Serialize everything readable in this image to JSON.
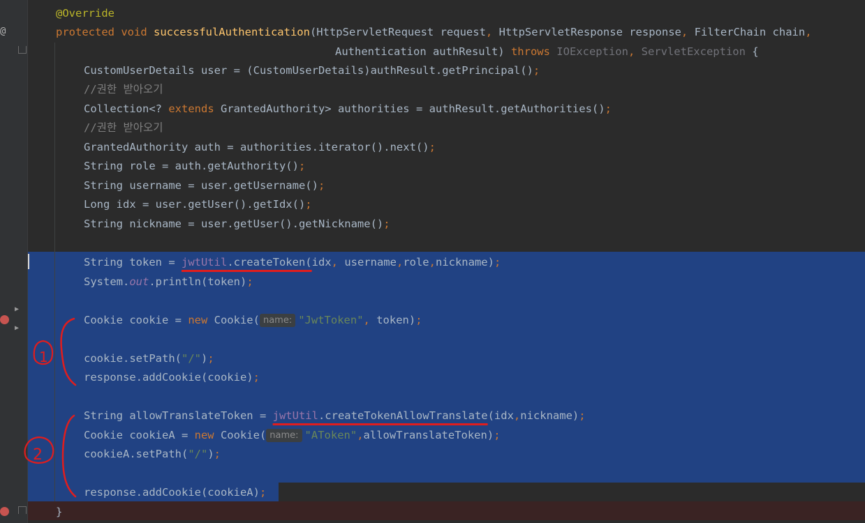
{
  "editor": {
    "lines": [
      {
        "id": "l1",
        "tokens": [
          {
            "t": "@Override",
            "c": "ann"
          }
        ]
      },
      {
        "id": "l2",
        "tokens": [
          {
            "t": "protected void ",
            "c": "kw"
          },
          {
            "t": "successfulAuthentication",
            "c": "fn"
          },
          {
            "t": "(HttpServletRequest request"
          },
          {
            "t": ", ",
            "c": "kw"
          },
          {
            "t": "HttpServletResponse response"
          },
          {
            "t": ", ",
            "c": "kw"
          },
          {
            "t": "FilterChain chain"
          },
          {
            "t": ",",
            "c": "kw"
          }
        ]
      },
      {
        "id": "l3",
        "tokens": [
          {
            "t": "Authentication authResult) "
          },
          {
            "t": "throws ",
            "c": "kw"
          },
          {
            "t": "IOException",
            "c": "dim"
          },
          {
            "t": ", ",
            "c": "kw"
          },
          {
            "t": "ServletException",
            "c": "dim"
          },
          {
            "t": " {"
          }
        ]
      },
      {
        "id": "l4",
        "tokens": [
          {
            "t": "CustomUserDetails user = (CustomUserDetails)authResult.getPrincipal()"
          },
          {
            "t": ";",
            "c": "kw"
          }
        ]
      },
      {
        "id": "l5",
        "tokens": [
          {
            "t": "//권한 받아오기",
            "c": "cm"
          }
        ]
      },
      {
        "id": "l6",
        "tokens": [
          {
            "t": "Collection<? "
          },
          {
            "t": "extends ",
            "c": "kw"
          },
          {
            "t": "GrantedAuthority> authorities = authResult.getAuthorities()"
          },
          {
            "t": ";",
            "c": "kw"
          }
        ]
      },
      {
        "id": "l7",
        "tokens": [
          {
            "t": "//권한 받아오기",
            "c": "cm"
          }
        ]
      },
      {
        "id": "l8",
        "tokens": [
          {
            "t": "GrantedAuthority auth = authorities.iterator().next()"
          },
          {
            "t": ";",
            "c": "kw"
          }
        ]
      },
      {
        "id": "l9",
        "tokens": [
          {
            "t": "String role = auth.getAuthority()"
          },
          {
            "t": ";",
            "c": "kw"
          }
        ]
      },
      {
        "id": "l10",
        "tokens": [
          {
            "t": "String username = user.getUsername()"
          },
          {
            "t": ";",
            "c": "kw"
          }
        ]
      },
      {
        "id": "l11",
        "tokens": [
          {
            "t": "Long idx = user.getUser().getIdx()"
          },
          {
            "t": ";",
            "c": "kw"
          }
        ]
      },
      {
        "id": "l12",
        "tokens": [
          {
            "t": "String nickname = user.getUser().getNickname()"
          },
          {
            "t": ";",
            "c": "kw"
          }
        ]
      },
      {
        "id": "l13",
        "tokens": []
      },
      {
        "id": "l14",
        "tokens": [
          {
            "t": "String token = "
          },
          {
            "t": "jwtUtil",
            "c": "fld ul"
          },
          {
            "t": ".createToken(",
            "c": "ul"
          },
          {
            "t": "idx"
          },
          {
            "t": ", ",
            "c": "kw"
          },
          {
            "t": "username"
          },
          {
            "t": ",",
            "c": "kw"
          },
          {
            "t": "role"
          },
          {
            "t": ",",
            "c": "kw"
          },
          {
            "t": "nickname)"
          },
          {
            "t": ";",
            "c": "kw"
          }
        ]
      },
      {
        "id": "l15",
        "tokens": [
          {
            "t": "System."
          },
          {
            "t": "out",
            "c": "stat"
          },
          {
            "t": ".println(token)"
          },
          {
            "t": ";",
            "c": "kw"
          }
        ]
      },
      {
        "id": "l16",
        "tokens": []
      },
      {
        "id": "l17",
        "tokens": [
          {
            "t": "Cookie cookie = "
          },
          {
            "t": "new ",
            "c": "kw"
          },
          {
            "t": "Cookie("
          },
          {
            "t": "name:",
            "c": "hint"
          },
          {
            "t": "\"JwtToken\"",
            "c": "str"
          },
          {
            "t": ", ",
            "c": "kw"
          },
          {
            "t": "token)"
          },
          {
            "t": ";",
            "c": "kw"
          }
        ]
      },
      {
        "id": "l18",
        "tokens": []
      },
      {
        "id": "l19",
        "tokens": [
          {
            "t": "cookie.setPath("
          },
          {
            "t": "\"/\"",
            "c": "str"
          },
          {
            "t": ")"
          },
          {
            "t": ";",
            "c": "kw"
          }
        ]
      },
      {
        "id": "l20",
        "tokens": [
          {
            "t": "response.addCookie(cookie)"
          },
          {
            "t": ";",
            "c": "kw"
          }
        ]
      },
      {
        "id": "l21",
        "tokens": []
      },
      {
        "id": "l22",
        "tokens": [
          {
            "t": "String allowTranslateToken = "
          },
          {
            "t": "jwtUtil",
            "c": "fld ul"
          },
          {
            "t": ".createTokenAllowTranslate",
            "c": "ul"
          },
          {
            "t": "(idx"
          },
          {
            "t": ",",
            "c": "kw"
          },
          {
            "t": "nickname)"
          },
          {
            "t": ";",
            "c": "kw"
          }
        ]
      },
      {
        "id": "l23",
        "tokens": [
          {
            "t": "Cookie cookieA = "
          },
          {
            "t": "new ",
            "c": "kw"
          },
          {
            "t": "Cookie("
          },
          {
            "t": "name:",
            "c": "hint"
          },
          {
            "t": "\"AToken\"",
            "c": "str"
          },
          {
            "t": ",",
            "c": "kw"
          },
          {
            "t": "allowTranslateToken)"
          },
          {
            "t": ";",
            "c": "kw"
          }
        ]
      },
      {
        "id": "l24",
        "tokens": [
          {
            "t": "cookieA.setPath("
          },
          {
            "t": "\"/\"",
            "c": "str"
          },
          {
            "t": ")"
          },
          {
            "t": ";",
            "c": "kw"
          }
        ]
      },
      {
        "id": "l25",
        "tokens": []
      },
      {
        "id": "l26",
        "tokens": [
          {
            "t": "response.addCookie(cookieA)"
          },
          {
            "t": ";",
            "c": "kw"
          }
        ]
      },
      {
        "id": "l27",
        "tokens": [
          {
            "t": "}"
          }
        ]
      }
    ]
  },
  "gutter": {
    "override_marker": "@",
    "fold_markers": [
      "▶",
      "▶"
    ]
  },
  "annotations": {
    "mark_1": "1",
    "mark_2": "2",
    "ink_color": "#e11d1d"
  },
  "theme": {
    "background": "#2b2b2b",
    "selection": "#214283",
    "keyword": "#cc7832",
    "method": "#ffc66d",
    "string": "#6a8759",
    "field": "#9876aa",
    "comment": "#808080",
    "annotation": "#bbb529",
    "breakpoint": "#c75450"
  }
}
